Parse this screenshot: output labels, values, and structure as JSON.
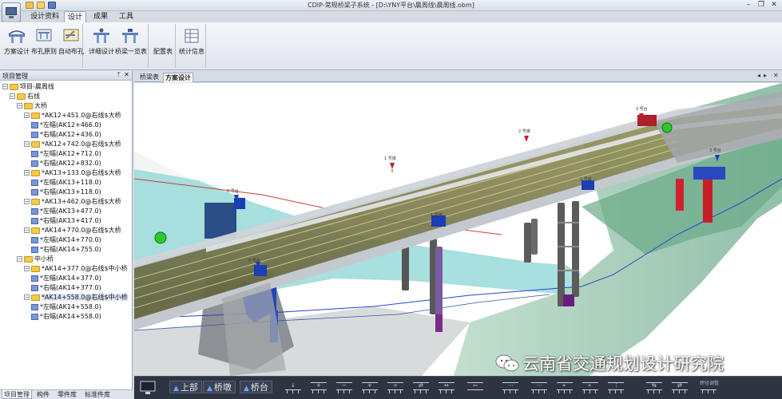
{
  "window": {
    "title": "CDIP-常规桥梁子系统 - [D:\\YNY平台\\晨周线\\晨周线.obm]",
    "controls": [
      "minimize-icon",
      "restore-icon",
      "close-icon"
    ]
  },
  "menu": {
    "tabs": [
      {
        "label": "设计资料",
        "active": false
      },
      {
        "label": "设计",
        "active": true
      },
      {
        "label": "成果",
        "active": false
      },
      {
        "label": "工具",
        "active": false
      }
    ]
  },
  "ribbon": {
    "groups": [
      {
        "buttons": [
          {
            "label": "方案设计",
            "icon": "bridge-scheme-icon"
          },
          {
            "label": "布孔原则",
            "icon": "span-rule-icon"
          },
          {
            "label": "自动布孔",
            "icon": "auto-span-icon"
          }
        ]
      },
      {
        "buttons": [
          {
            "label": "详细设计",
            "icon": "detail-design-icon"
          },
          {
            "label": "桥梁一览表",
            "icon": "bridge-list-icon"
          }
        ]
      },
      {
        "buttons": [
          {
            "label": "配置表",
            "icon": "config-table-icon"
          }
        ]
      },
      {
        "buttons": [
          {
            "label": "统计信息",
            "icon": "statistics-icon"
          }
        ]
      }
    ]
  },
  "left_panel": {
    "title": "项目管理",
    "tree": [
      {
        "level": 0,
        "type": "folder",
        "label": "项目-晨周线",
        "expanded": true
      },
      {
        "level": 1,
        "type": "folder",
        "label": "右线",
        "expanded": true
      },
      {
        "level": 2,
        "type": "folder",
        "label": "大桥",
        "expanded": true
      },
      {
        "level": 3,
        "type": "folder",
        "label": "*AK12+451.0@右线$大桥",
        "expanded": true
      },
      {
        "level": 4,
        "type": "leaf",
        "label": "*左幅(AK12+466.0)"
      },
      {
        "level": 4,
        "type": "leaf",
        "label": "*右幅(AK12+436.0)"
      },
      {
        "level": 3,
        "type": "folder",
        "label": "*AK12+742.0@右线$大桥",
        "expanded": true
      },
      {
        "level": 4,
        "type": "leaf",
        "label": "*左幅(AK12+712.0)"
      },
      {
        "level": 4,
        "type": "leaf",
        "label": "*右幅(AK12+832.0)"
      },
      {
        "level": 3,
        "type": "folder",
        "label": "*AK13+133.0@右线$大桥",
        "expanded": true
      },
      {
        "level": 4,
        "type": "leaf",
        "label": "*左幅(AK13+118.0)"
      },
      {
        "level": 4,
        "type": "leaf",
        "label": "*右幅(AK13+118.0)"
      },
      {
        "level": 3,
        "type": "folder",
        "label": "*AK13+462.0@右线$大桥",
        "expanded": true
      },
      {
        "level": 4,
        "type": "leaf",
        "label": "*左幅(AK13+477.0)"
      },
      {
        "level": 4,
        "type": "leaf",
        "label": "*右幅(AK13+417.0)"
      },
      {
        "level": 3,
        "type": "folder",
        "label": "*AK14+770.0@右线$大桥",
        "expanded": true
      },
      {
        "level": 4,
        "type": "leaf",
        "label": "*左幅(AK14+770.0)"
      },
      {
        "level": 4,
        "type": "leaf",
        "label": "*右幅(AK14+755.0)"
      },
      {
        "level": 2,
        "type": "folder",
        "label": "中小桥",
        "expanded": true
      },
      {
        "level": 3,
        "type": "folder",
        "label": "*AK14+377.0@右线$中小桥",
        "expanded": true
      },
      {
        "level": 4,
        "type": "leaf",
        "label": "*左幅(AK14+377.0)"
      },
      {
        "level": 4,
        "type": "leaf",
        "label": "*右幅(AK14+377.0)"
      },
      {
        "level": 3,
        "type": "folder",
        "label": "*AK14+558.0@右线$中小桥",
        "expanded": true,
        "selected": true
      },
      {
        "level": 4,
        "type": "leaf",
        "label": "*左幅(AK14+558.0)"
      },
      {
        "level": 4,
        "type": "leaf",
        "label": "*右幅(AK14+558.0)"
      }
    ],
    "bottom_tabs": [
      {
        "label": "项目管理",
        "active": true
      },
      {
        "label": "构件",
        "active": false
      },
      {
        "label": "零件库",
        "active": false
      },
      {
        "label": "标准件库",
        "active": false
      }
    ]
  },
  "doc_tabs": [
    {
      "label": "桥梁表",
      "active": false
    },
    {
      "label": "方案设计",
      "active": true
    }
  ],
  "scene": {
    "pier_labels": [
      "0 号台",
      "1 号墩",
      "1 号墩",
      "2 号墩",
      "2 号墩",
      "3 号台",
      "3 号台",
      "0 号台"
    ]
  },
  "watermark": {
    "text": "云南省交通规划设计研究院",
    "icon": "wechat-icon"
  },
  "bottom_toolbar": {
    "labels": [
      "上部",
      "桥墩",
      "桥台"
    ],
    "small_text": "跨径调整"
  },
  "colors": {
    "accent_blue": "#2b5fd9",
    "pier_red": "#d0222e",
    "cap_blue": "#1a3fb4",
    "terrain_cyan": "#9fdcdc",
    "ribbon_bg": "#e6eaf0"
  }
}
